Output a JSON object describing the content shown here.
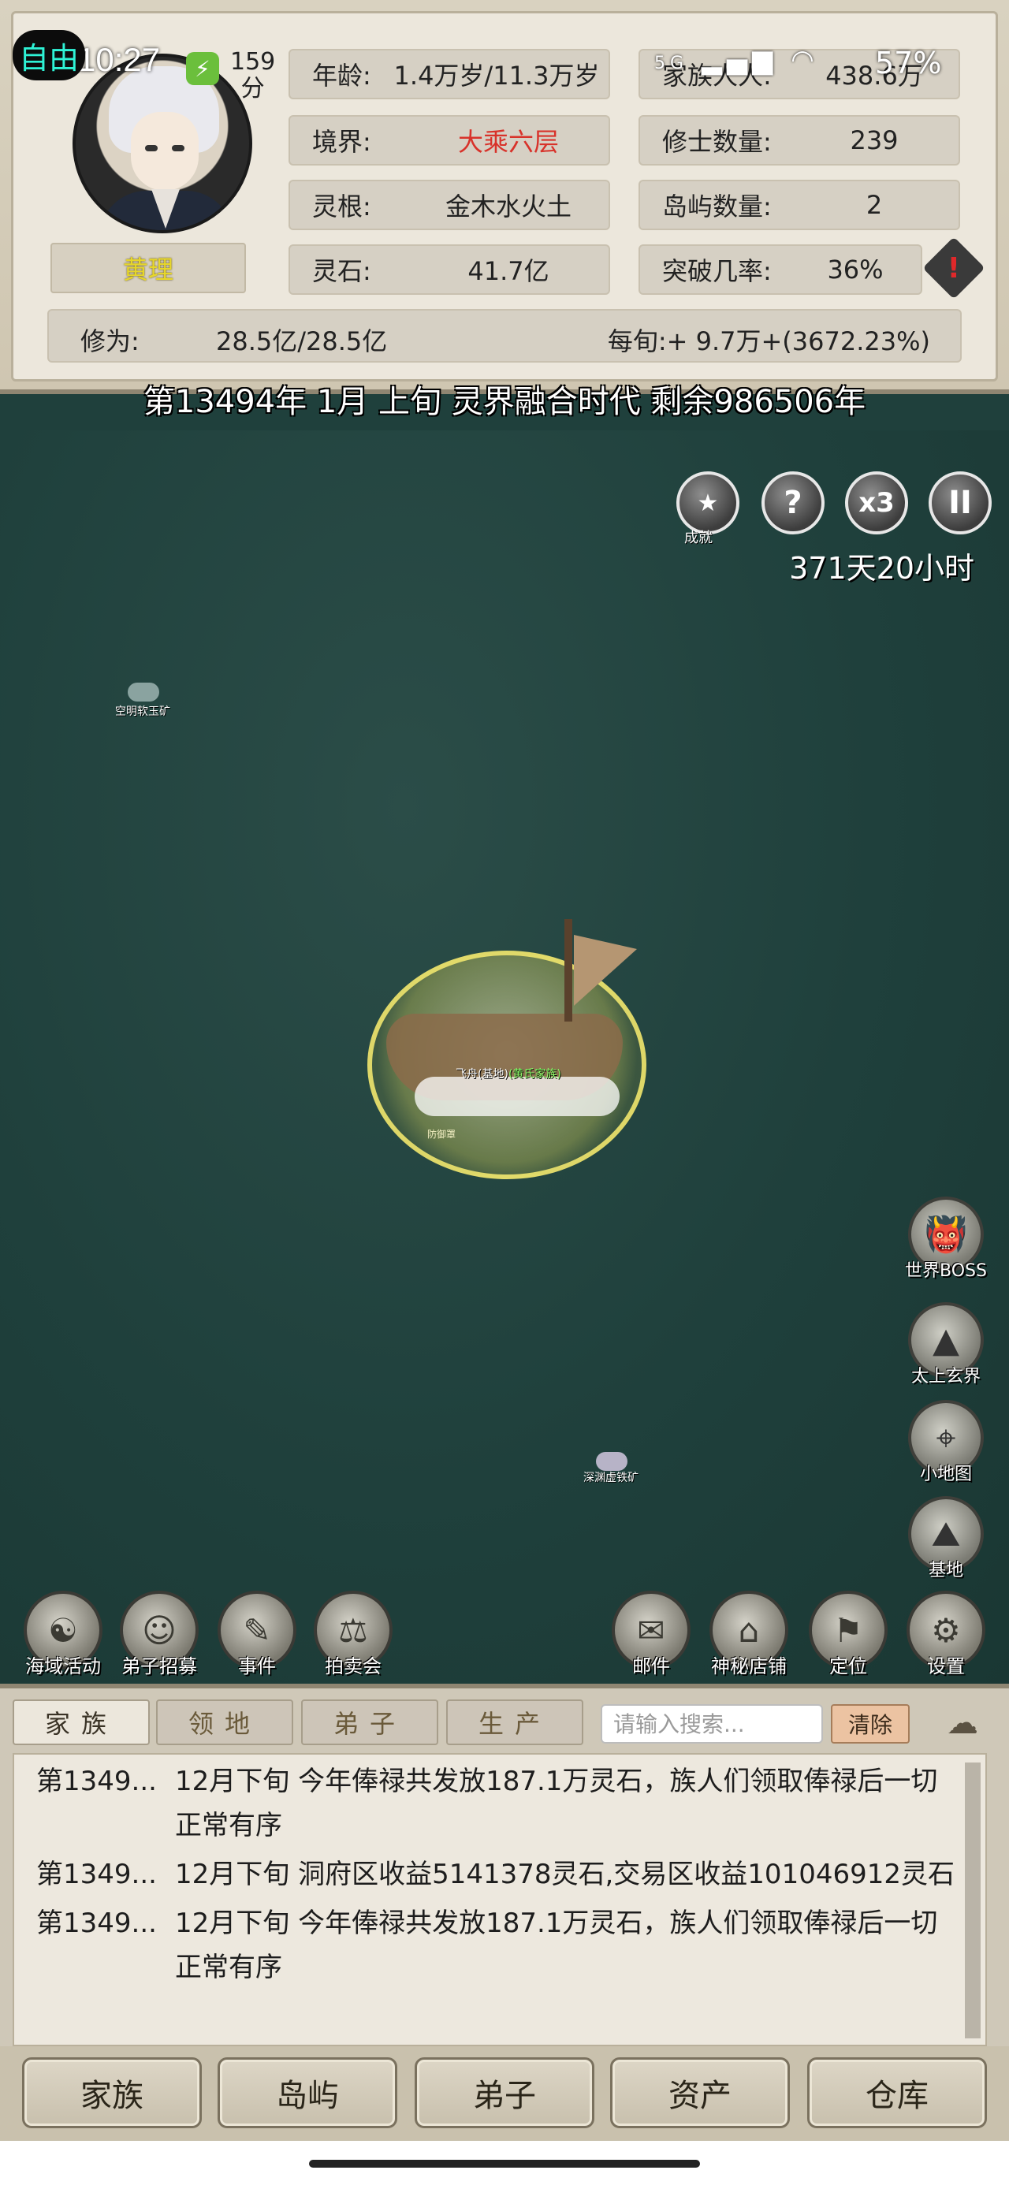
{
  "status_bar": {
    "free_badge": "自由",
    "time": "10:27",
    "score_value": "159",
    "score_unit": "分",
    "network": "5G",
    "battery": "57%"
  },
  "character": {
    "name": "黄理"
  },
  "stats": {
    "age_label": "年龄:",
    "age_value": "1.4万岁/11.3万岁",
    "clan_label": "家族人人:",
    "clan_value": "438.6万",
    "realm_label": "境界:",
    "realm_value": "大乘六层",
    "cultivators_label": "修士数量:",
    "cultivators_value": "239",
    "root_label": "灵根:",
    "root_value": "金木水火土",
    "islands_label": "岛屿数量:",
    "islands_value": "2",
    "stones_label": "灵石:",
    "stones_value": "41.7亿",
    "breakthrough_label": "突破几率:",
    "breakthrough_value": "36%",
    "cultivation_label": "修为:",
    "cultivation_value": "28.5亿/28.5亿",
    "per_ten_days": "每旬:+ 9.7万+(3672.23%)"
  },
  "date_banner": "第13494年 1月 上旬  灵界融合时代 剩余986506年",
  "map": {
    "top_buttons": {
      "achievement_label": "成就",
      "help": "?",
      "speed": "x3",
      "pause": "II"
    },
    "timer": "371天20小时",
    "mine_1": "空明软玉矿",
    "mine_2": "深渊虚铁矿",
    "airship_label_prefix": "飞舟(基地)",
    "airship_label_clan": "(黄氏家族)",
    "shield_label": "防御罩",
    "right_buttons": [
      {
        "label": "世界BOSS"
      },
      {
        "label": "太上玄界"
      },
      {
        "label": "小地图"
      },
      {
        "label": "基地"
      }
    ],
    "bottom_tools": [
      {
        "label": "海域活动"
      },
      {
        "label": "弟子招募"
      },
      {
        "label": "事件"
      },
      {
        "label": "拍卖会"
      },
      {
        "label": "邮件"
      },
      {
        "label": "神秘店铺"
      },
      {
        "label": "定位"
      },
      {
        "label": "设置"
      }
    ]
  },
  "log_panel": {
    "tabs": [
      "家族",
      "领地",
      "弟子",
      "生产"
    ],
    "search_placeholder": "请输入搜索...",
    "clear_label": "清除",
    "entries": [
      {
        "year": "第1349...",
        "text": "12月下旬 今年俸禄共发放187.1万灵石，族人们领取俸禄后一切正常有序"
      },
      {
        "year": "第1349...",
        "text": "12月下旬 洞府区收益5141378灵石,交易区收益101046912灵石"
      },
      {
        "year": "第1349...",
        "text": "12月下旬 今年俸禄共发放187.1万灵石，族人们领取俸禄后一切正常有序"
      }
    ]
  },
  "bottom_nav": [
    "家族",
    "岛屿",
    "弟子",
    "资产",
    "仓库"
  ]
}
